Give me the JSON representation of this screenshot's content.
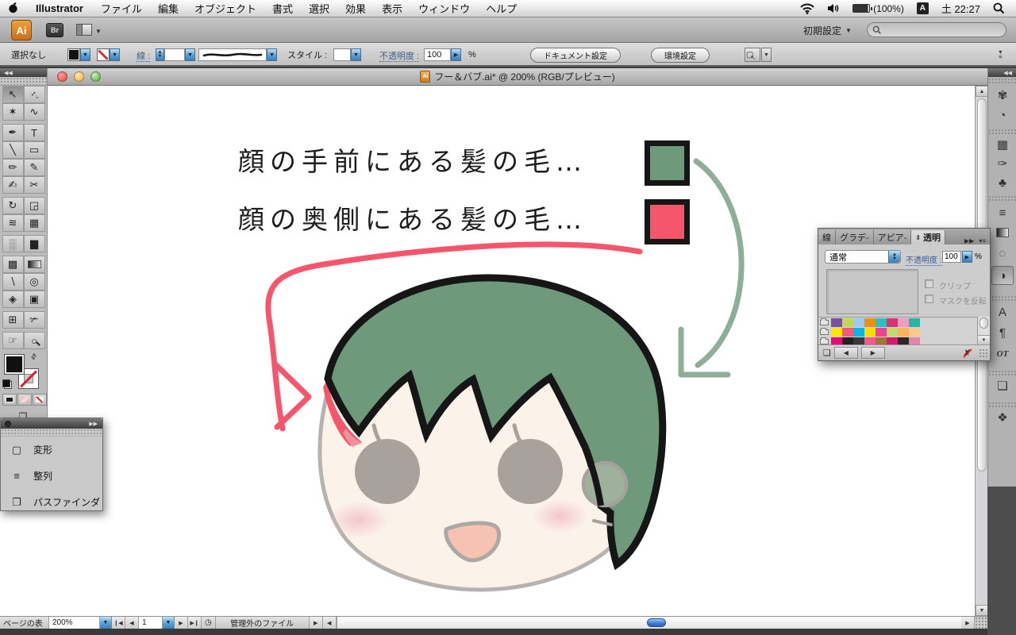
{
  "menu_bar": {
    "app_name": "Illustrator",
    "items": [
      "ファイル",
      "編集",
      "オブジェクト",
      "書式",
      "選択",
      "効果",
      "表示",
      "ウィンドウ",
      "ヘルプ"
    ],
    "battery": "(100%)",
    "input_method": "A",
    "clock": "土 22:27"
  },
  "app_bar": {
    "ai_logo": "Ai",
    "bridge_label": "Br",
    "workspace": "初期設定"
  },
  "control_bar": {
    "selection_status": "選択なし",
    "stroke_label": "線 :",
    "style_label": "スタイル :",
    "opacity_label": "不透明度 :",
    "opacity_value": "100",
    "percent": "%",
    "document_setup": "ドキュメント設定",
    "preferences": "環境設定"
  },
  "window": {
    "title": "フー＆バブ.ai* @ 200% (RGB/プレビュー)",
    "doc_icon": "Ai"
  },
  "toolbar": {
    "tools": [
      "↖",
      "↖",
      "✶",
      "∿",
      "✒",
      "T",
      "╲",
      "▭",
      "✏",
      "✎",
      "✍",
      "✂",
      "↻",
      "◲",
      "≋",
      "▦",
      "░",
      "▆",
      "▩",
      "▨",
      "∖",
      "◎",
      "◈",
      "▣",
      "⊞",
      "✃",
      "☞",
      "○"
    ],
    "screen_mode": "❐",
    "swap_icon": "⇄",
    "collapse": "◀◀"
  },
  "artwork": {
    "caption_front": "顔の手前にある髪の毛…",
    "caption_back": "顔の奥側にある髪の毛…",
    "front_hair_swatch": "#6E9A7B",
    "back_hair_swatch": "#F5566B",
    "hair_color": "#6E9A7B",
    "face_color": "#FBF2EA",
    "face_outline_color": "#B5B2AF",
    "eye_color": "#A8A19C",
    "mouth_color": "#F6C3B2",
    "mouth_outline_color": "#ABA8A5",
    "ear_color": "#9EB29B",
    "red_arrow_color": "#F5566B",
    "green_arrow_color": "#8FAE97"
  },
  "transform_panel": {
    "items": [
      {
        "icon": "▢",
        "label": "変形"
      },
      {
        "icon": "≡",
        "label": "整列"
      },
      {
        "icon": "❒",
        "label": "パスファインダ"
      }
    ],
    "expand_icon": "▶▶"
  },
  "transparency_panel": {
    "tabs": [
      "線",
      "グラデ-",
      "アピア-",
      "透明"
    ],
    "active_tab": "透明",
    "expand_icon": "▶▶",
    "menu_icon": "▾≡",
    "blend_mode": "通常",
    "opacity_label": "不透明度 :",
    "opacity_value": "100",
    "percent": "%",
    "clip_label": "クリップ",
    "invert_mask_label": "マスクを反転",
    "swatches": [
      [
        "#7B51A1",
        "#C3D655",
        "#9FC9EF",
        "#E8920F",
        "#2FBFC0",
        "#D93571",
        "#F29CC0",
        "#2BB3A5"
      ],
      [
        "#FFE60A",
        "#F8587E",
        "#0BB5E2",
        "#FFDC00",
        "#EF3F97",
        "#BFDB72",
        "#FFB35F",
        "#F9C98E"
      ],
      [
        "#E30980",
        "#25201F",
        "#3B3637",
        "#EE5A8D",
        "#9F7434",
        "#D41C6F",
        "#2E2728",
        "#E087AB"
      ]
    ]
  },
  "dock": {
    "icons": [
      "✾",
      "◔",
      "▦",
      "✑",
      "♣",
      "≡",
      "",
      "◌",
      "◑",
      "A",
      "¶",
      "OT",
      "❏",
      "❖"
    ],
    "collapse": "◀◀"
  },
  "status_bar": {
    "left_text": "ページの表",
    "zoom_value": "200%",
    "page_number": "1",
    "file_status": "管理外のファイル"
  }
}
